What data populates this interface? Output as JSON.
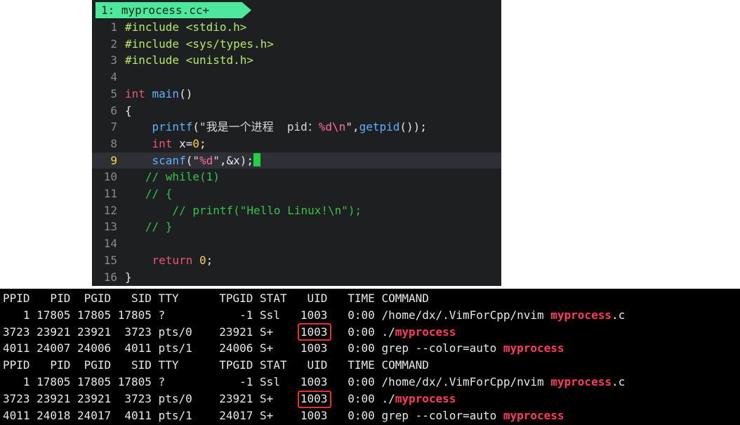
{
  "editor": {
    "tab_label": "1: myprocess.cc+",
    "lines": [
      {
        "n": "1",
        "parts": [
          [
            "inc",
            "#include "
          ],
          [
            "inc",
            "<stdio.h>"
          ]
        ]
      },
      {
        "n": "2",
        "parts": [
          [
            "inc",
            "#include "
          ],
          [
            "inc",
            "<sys/types.h>"
          ]
        ]
      },
      {
        "n": "3",
        "parts": [
          [
            "inc",
            "#include "
          ],
          [
            "inc",
            "<unistd.h>"
          ]
        ]
      },
      {
        "n": "4",
        "parts": []
      },
      {
        "n": "5",
        "parts": [
          [
            "kw",
            "int "
          ],
          [
            "fn",
            "main"
          ],
          [
            "",
            "()"
          ]
        ]
      },
      {
        "n": "6",
        "parts": [
          [
            "",
            "{"
          ]
        ]
      },
      {
        "n": "7",
        "parts": [
          [
            "",
            "    "
          ],
          [
            "fn",
            "printf"
          ],
          [
            "",
            "("
          ],
          [
            "str",
            "\"我是一个进程  pid："
          ],
          [
            "fmt",
            "%d\\n"
          ],
          [
            "str",
            "\""
          ],
          [
            "",
            ","
          ],
          [
            "fn",
            "getpid"
          ],
          [
            "",
            "());"
          ]
        ]
      },
      {
        "n": "8",
        "parts": [
          [
            "",
            "    "
          ],
          [
            "kw",
            "int "
          ],
          [
            "",
            "x="
          ],
          [
            "num",
            "0"
          ],
          [
            "",
            ";"
          ]
        ]
      },
      {
        "n": "9",
        "current": true,
        "parts": [
          [
            "",
            "    "
          ],
          [
            "fn",
            "scanf"
          ],
          [
            "",
            "("
          ],
          [
            "str",
            "\""
          ],
          [
            "fmt",
            "%d"
          ],
          [
            "str",
            "\""
          ],
          [
            "",
            ",&x);"
          ]
        ]
      },
      {
        "n": "10",
        "parts": [
          [
            "cm",
            "   // while(1)"
          ]
        ]
      },
      {
        "n": "11",
        "parts": [
          [
            "cm",
            "   // {"
          ]
        ]
      },
      {
        "n": "12",
        "parts": [
          [
            "cm",
            "       // printf(\"Hello Linux!\\n\");"
          ]
        ]
      },
      {
        "n": "13",
        "parts": [
          [
            "cm",
            "   // }"
          ]
        ]
      },
      {
        "n": "14",
        "parts": []
      },
      {
        "n": "15",
        "parts": [
          [
            "",
            "    "
          ],
          [
            "kw",
            "return "
          ],
          [
            "num",
            "0"
          ],
          [
            "",
            ";"
          ]
        ]
      },
      {
        "n": "16",
        "parts": [
          [
            "",
            "}"
          ]
        ]
      }
    ]
  },
  "terminal": {
    "header": "PPID   PID  PGID   SID TTY      TPGID STAT   UID   TIME COMMAND",
    "groups": [
      [
        {
          "prefix": "   1 17805 17805 17805 ?           -1 Ssl   1003   0:00 /home/dx/.VimForCpp/nvim ",
          "hl": "myprocess",
          "suffix": ".c"
        },
        {
          "prefix": "3723 23921 23921  3723 pts/0    23921 S+    1003   0:00 ./",
          "hl": "myprocess",
          "suffix": ""
        },
        {
          "prefix": "4011 24007 24006  4011 pts/1    24006 S+    1003   0:00 grep --color=auto ",
          "hl": "myprocess",
          "suffix": ""
        }
      ],
      [
        {
          "prefix": "   1 17805 17805 17805 ?           -1 Ssl   1003   0:00 /home/dx/.VimForCpp/nvim ",
          "hl": "myprocess",
          "suffix": ".c"
        },
        {
          "prefix": "3723 23921 23921  3723 pts/0    23921 S+    1003   0:00 ./",
          "hl": "myprocess",
          "suffix": ""
        },
        {
          "prefix": "4011 24018 24017  4011 pts/1    24017 S+    1003   0:00 grep --color=auto ",
          "hl": "myprocess",
          "suffix": ""
        }
      ]
    ]
  }
}
